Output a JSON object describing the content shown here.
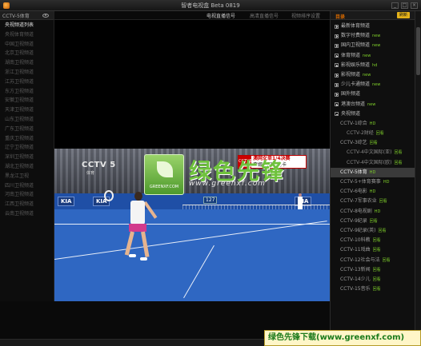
{
  "window": {
    "title": "智者电视盒 Beta 0819",
    "controls": [
      "_",
      "□",
      "×"
    ]
  },
  "left_panel": {
    "header": "CCTV-5体育",
    "channels": [
      "央视频道列表",
      "央视体育频道",
      "中国卫视频道",
      "北京卫视频道",
      "湖南卫视频道",
      "浙江卫视频道",
      "江苏卫视频道",
      "东方卫视频道",
      "安徽卫视频道",
      "天津卫视频道",
      "山东卫视频道",
      "广东卫视频道",
      "重庆卫视频道",
      "辽宁卫视频道",
      "深圳卫视频道",
      "湖北卫视频道",
      "黑龙江卫视",
      "四川卫视频道",
      "河南卫视频道",
      "江西卫视频道",
      "云南卫视频道"
    ]
  },
  "tabs": [
    {
      "label": "电视直播信号"
    },
    {
      "label": "高清直播信号"
    },
    {
      "label": "视频排序设置"
    }
  ],
  "video": {
    "channel_logo": "CCTV 5",
    "channel_sub": "体育",
    "score_badge": "CCTV5",
    "score_line1": "澳网女单1/4决赛",
    "score_line2": "李娜 - 阿扎伦卡",
    "wall_logos": [
      "KIA",
      "KIA",
      "KIA"
    ],
    "speed_board": "127",
    "watermark_small": "GREENXF.COM",
    "watermark_text": "绿色先锋",
    "watermark_url": "www.greenxf.com"
  },
  "right_panel": {
    "header_label": "目录",
    "header_button": "刷新",
    "categories": [
      {
        "label": "最新体育频道",
        "level": 0,
        "icon": "plus"
      },
      {
        "label": "数字付费频道",
        "level": 0,
        "icon": "plus",
        "tag": "new"
      },
      {
        "label": "国内卫视频道",
        "level": 0,
        "icon": "plus",
        "tag": "new"
      },
      {
        "label": "体育频道",
        "level": 0,
        "icon": "plus",
        "tag": "new"
      },
      {
        "label": "影视娱乐频道",
        "level": 0,
        "icon": "plus",
        "tag": "hd"
      },
      {
        "label": "影视频道",
        "level": 0,
        "icon": "plus",
        "tag": "new"
      },
      {
        "label": "少儿卡通频道",
        "level": 0,
        "icon": "plus",
        "tag": "new"
      },
      {
        "label": "国外频道",
        "level": 0,
        "icon": "plus"
      },
      {
        "label": "港澳台频道",
        "level": 0,
        "icon": "plus",
        "tag": "new"
      },
      {
        "label": "央视频道",
        "level": 0,
        "icon": "minus"
      },
      {
        "label": "CCTV-1综合",
        "level": 1,
        "icon": "none",
        "tag": "HD"
      },
      {
        "label": "CCTV-2财经",
        "level": 2,
        "icon": "none",
        "tag": "回看"
      },
      {
        "label": "CCTV-3综艺",
        "level": 1,
        "icon": "none",
        "tag": "回看"
      },
      {
        "label": "CCTV-4中文国际(亚)",
        "level": 2,
        "icon": "none",
        "tag": "回看"
      },
      {
        "label": "CCTV-4中文国际(欧)",
        "level": 2,
        "icon": "none",
        "tag": "回看"
      },
      {
        "label": "CCTV-5体育",
        "level": 1,
        "icon": "none",
        "tag": "HD",
        "selected": true
      },
      {
        "label": "CCTV-5+体育赛事",
        "level": 1,
        "icon": "none",
        "tag": "HD"
      },
      {
        "label": "CCTV-6电影",
        "level": 1,
        "icon": "none",
        "tag": "HD"
      },
      {
        "label": "CCTV-7军事农业",
        "level": 1,
        "icon": "none",
        "tag": "回看"
      },
      {
        "label": "CCTV-8电视剧",
        "level": 1,
        "icon": "none",
        "tag": "HD"
      },
      {
        "label": "CCTV-9纪录",
        "level": 1,
        "icon": "none",
        "tag": "回看"
      },
      {
        "label": "CCTV-9纪录(英)",
        "level": 1,
        "icon": "none",
        "tag": "回看"
      },
      {
        "label": "CCTV-10科教",
        "level": 1,
        "icon": "none",
        "tag": "回看"
      },
      {
        "label": "CCTV-11戏曲",
        "level": 1,
        "icon": "none",
        "tag": "回看"
      },
      {
        "label": "CCTV-12社会与法",
        "level": 1,
        "icon": "none",
        "tag": "回看"
      },
      {
        "label": "CCTV-13新闻",
        "level": 1,
        "icon": "none",
        "tag": "回看"
      },
      {
        "label": "CCTV-14少儿",
        "level": 1,
        "icon": "none",
        "tag": "回看"
      },
      {
        "label": "CCTV-15音乐",
        "level": 1,
        "icon": "none",
        "tag": "回看"
      }
    ]
  },
  "banner": {
    "text": "绿色先锋下载(www.greenxf.com)"
  },
  "colors": {
    "accent": "#d86a00",
    "tag_green": "#7fcf2a",
    "court_blue": "#2f67c2"
  }
}
